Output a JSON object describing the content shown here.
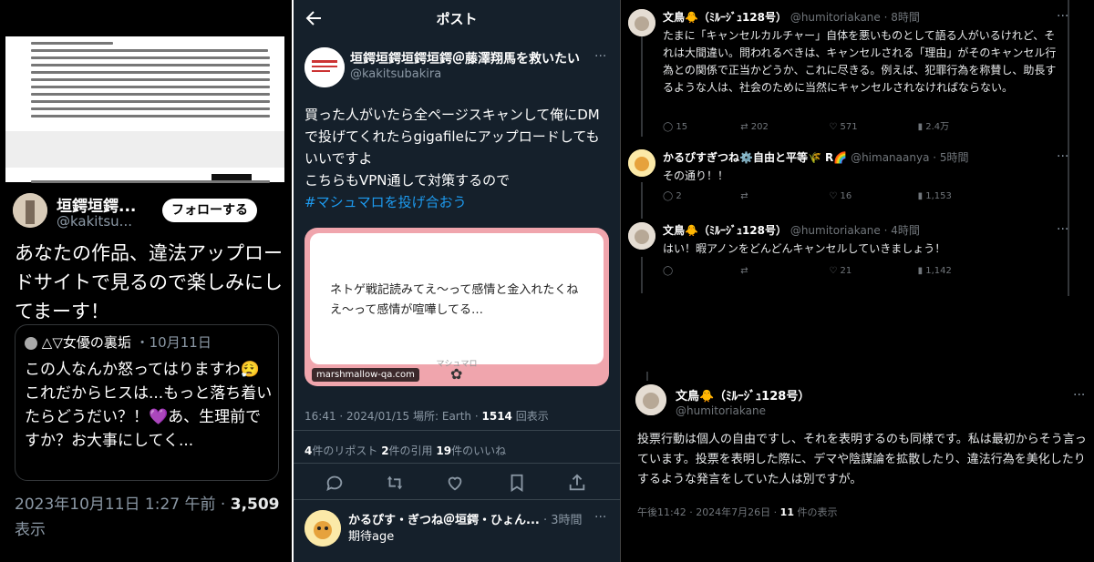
{
  "panel1": {
    "user_name": "垣鍔垣鍔...",
    "user_handle": "@kakitsu...",
    "follow_label": "フォローする",
    "tweet_text": "あなたの作品、違法アップロードサイトで見るので楽しみにしてまーす！",
    "quote": {
      "name": "△▽女優の裏垢",
      "date": "・10月11日",
      "text": "この人なんか怒ってはりますわ😮‍💨 これだからヒスは...もっと落ち着いたらどうだい？！💜あ、生理前ですか？お大事にしてく..."
    },
    "meta_time": "2023年10月11日 1:27 午前 · ",
    "meta_views": "3,509",
    "meta_views_label": "表示"
  },
  "panel2": {
    "title": "ポスト",
    "user_name": "垣鍔垣鍔垣鍔垣鍔＠藤澤翔馬を救いたい",
    "user_handle": "@kakitsubakira",
    "text_main": "買った人がいたら全ページスキャンして俺にDMで投げてくれたらgigafileにアップロードしてもいいですよ\nこちらもVPN通して対策するので",
    "hashtag": "#マシュマロを投げ合おう",
    "card_text": "ネトゲ戦記読みてえ〜って感情と金入れたくねえ〜って感情が喧嘩してる…",
    "card_brand": "マシュマロ",
    "card_domain": "marshmallow-qa.com",
    "time": "16:41 · 2024/01/15 場所: Earth · ",
    "views": "1514",
    "views_label": " 回表示",
    "reposts": "4",
    "reposts_label": "件のリポスト ",
    "quotes": "2",
    "quotes_label": "件の引用 ",
    "likes": "19",
    "likes_label": "件のいいね",
    "reply": {
      "name": "かるぴす・ぎつね＠垣鍔・ひょん...",
      "time": " · 3時間",
      "text": "期待age"
    }
  },
  "panel3": {
    "tweets": [
      {
        "name": "文鳥🐥（ﾐﾙｰｼﾞｭ128号）",
        "meta": " @humitoriakane · 8時間",
        "text": "たまに「キャンセルカルチャー」自体を悪いものとして語る人がいるけれど、それは大間違い。問われるべきは、キャンセルされる「理由」がそのキャンセル行為との関係で正当かどうか、これに尽きる。例えば、犯罪行為を称賛し、助長するような人は、社会のために当然にキャンセルされなければならない。",
        "replies": "15",
        "reposts": "202",
        "likes": "571",
        "views": "2.4万"
      },
      {
        "name": "かるぴすぎつね⚙️自由と平等🌾 R🌈",
        "meta": " @himanaanya · 5時間",
        "text": "その通り！！",
        "replies": "2",
        "reposts": "",
        "likes": "16",
        "views": "1,153"
      },
      {
        "name": "文鳥🐥（ﾐﾙｰｼﾞｭ128号）",
        "meta": " @humitoriakane · 4時間",
        "text": "はい！暇アノンをどんどんキャンセルしていきましょう！",
        "replies": "",
        "reposts": "",
        "likes": "21",
        "views": "1,142"
      }
    ],
    "main": {
      "name": "文鳥🐥（ﾐﾙｰｼﾞｭ128号）",
      "handle": "@humitoriakane",
      "text": "投票行動は個人の自由ですし、それを表明するのも同様です。私は最初からそう言っています。投票を表明した際に、デマや陰謀論を拡散したり、違法行為を美化したりするような発言をしていた人は別ですが。",
      "time": "午後11:42 · 2024年7月26日 · ",
      "views": "11",
      "views_label": " 件の表示"
    }
  }
}
